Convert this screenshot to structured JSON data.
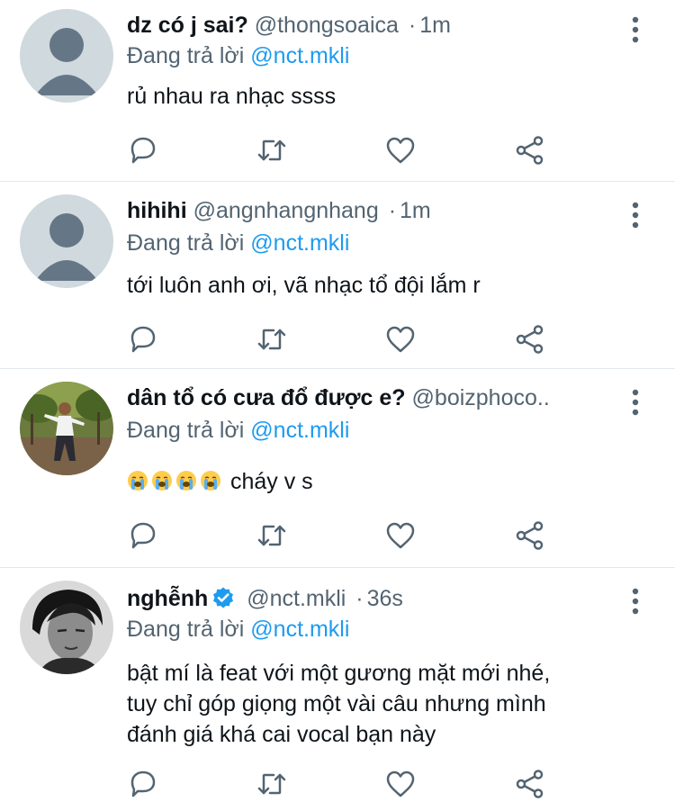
{
  "tweets": [
    {
      "name": "dz có j sai?",
      "handle": "@thongsoaica",
      "sep": "·",
      "time": "1m",
      "reply_prefix": "Đang trả lời",
      "reply_to": "@nct.mkli",
      "text": "rủ nhau ra nhạc ssss",
      "avatar": "default-avatar"
    },
    {
      "name": "hihihi",
      "handle": "@angnhangnhang",
      "sep": "·",
      "time": "1m",
      "reply_prefix": "Đang trả lời",
      "reply_to": "@nct.mkli",
      "text": "tới luôn anh ơi, vã nhạc tổ đội lắm r",
      "avatar": "default-avatar"
    },
    {
      "name": "dân tổ có cưa đổ được e?",
      "handle": "@boizphoco..",
      "reply_prefix": "Đang trả lời",
      "reply_to": "@nct.mkli",
      "text": "cháy v s",
      "emojis": [
        "loudly-crying-face",
        "loudly-crying-face",
        "loudly-crying-face",
        "loudly-crying-face"
      ],
      "avatar": "photo-man-in-orchard"
    },
    {
      "name": "nghễnh",
      "verified": true,
      "handle": "@nct.mkli",
      "sep": "·",
      "time": "36s",
      "reply_prefix": "Đang trả lời",
      "reply_to": "@nct.mkli",
      "text_lines": [
        "bật mí là feat với một gương mặt mới nhé,",
        "tuy chỉ góp giọng một vài câu nhưng mình",
        "đánh giá khá cai vocal bạn này"
      ],
      "avatar": "photo-bw-portrait"
    }
  ],
  "action_icons": [
    "reply-icon",
    "retweet-icon",
    "like-icon",
    "share-icon"
  ],
  "colors": {
    "text": "#0f1419",
    "secondary": "#536471",
    "link": "#1d9bf0",
    "divider": "#e1e8ed",
    "default_avatar_bg": "#cfd9de",
    "default_avatar_fg": "#657786"
  }
}
